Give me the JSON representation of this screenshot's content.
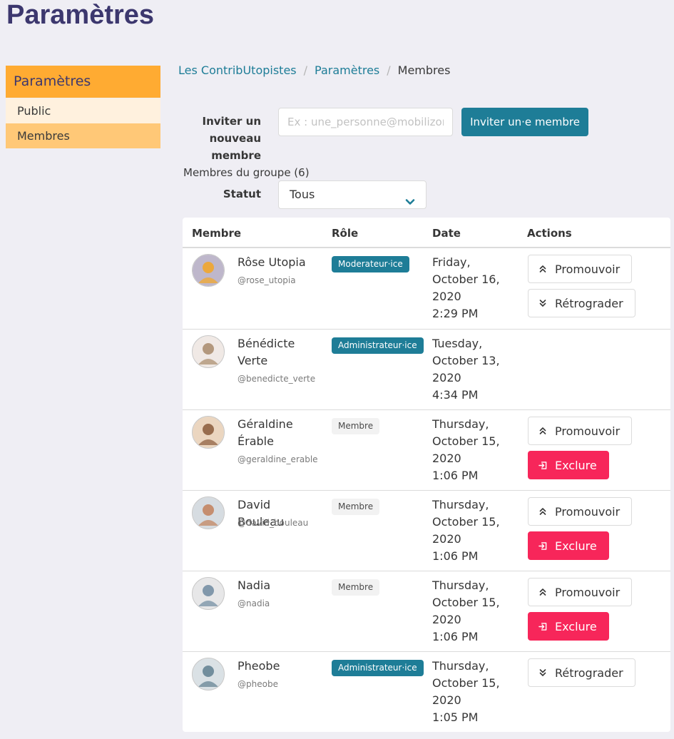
{
  "page": {
    "title": "Paramètres"
  },
  "sidebar": {
    "title": "Paramètres",
    "items": [
      {
        "label": "Public"
      },
      {
        "label": "Membres",
        "active": true
      }
    ]
  },
  "breadcrumb": [
    {
      "label": "Les ContribUtopistes"
    },
    {
      "label": "Paramètres"
    },
    {
      "label": "Membres"
    }
  ],
  "invite": {
    "label": "Inviter un nouveau membre",
    "placeholder": "Ex : une_personne@mobilizon.fr",
    "button": "Inviter un·e membre"
  },
  "group_members": {
    "label": "Membres du groupe (6)"
  },
  "status_filter": {
    "label": "Statut",
    "value": "Tous"
  },
  "table": {
    "headers": {
      "member": "Membre",
      "role": "Rôle",
      "date": "Date",
      "actions": "Actions"
    },
    "rows": [
      {
        "name": "Rôse Utopia",
        "handle": "@rose_utopia",
        "role": "Moderateur·ice",
        "role_style": "primary",
        "date": [
          "Friday,",
          "October 16,",
          "2020",
          "2:29 PM"
        ],
        "actions": [
          {
            "label": "Promouvoir",
            "kind": "promote"
          },
          {
            "label": "Rétrograder",
            "kind": "demote"
          }
        ]
      },
      {
        "name": "Bénédicte Verte",
        "handle": "@benedicte_verte",
        "role": "Administrateur·ice",
        "role_style": "primary",
        "date": [
          "Tuesday,",
          "October 13,",
          "2020",
          "4:34 PM"
        ],
        "actions": []
      },
      {
        "name": "Géraldine Érable",
        "handle": "@geraldine_erable",
        "role": "Membre",
        "role_style": "light",
        "date": [
          "Thursday,",
          "October 15,",
          "2020",
          "1:06 PM"
        ],
        "actions": [
          {
            "label": "Promouvoir",
            "kind": "promote"
          },
          {
            "label": "Exclure",
            "kind": "exclude"
          }
        ]
      },
      {
        "name": "David Bouleau",
        "handle": "@david_bouleau",
        "role": "Membre",
        "role_style": "light",
        "date": [
          "Thursday,",
          "October 15,",
          "2020",
          "1:06 PM"
        ],
        "actions": [
          {
            "label": "Promouvoir",
            "kind": "promote"
          },
          {
            "label": "Exclure",
            "kind": "exclude"
          }
        ]
      },
      {
        "name": "Nadia",
        "handle": "@nadia",
        "role": "Membre",
        "role_style": "light",
        "date": [
          "Thursday,",
          "October 15,",
          "2020",
          "1:06 PM"
        ],
        "actions": [
          {
            "label": "Promouvoir",
            "kind": "promote"
          },
          {
            "label": "Exclure",
            "kind": "exclude"
          }
        ]
      },
      {
        "name": "Pheobe",
        "handle": "@pheobe",
        "role": "Administrateur·ice",
        "role_style": "primary",
        "date": [
          "Thursday,",
          "October 15,",
          "2020",
          "1:05 PM"
        ],
        "actions": [
          {
            "label": "Rétrograder",
            "kind": "demote"
          }
        ]
      }
    ]
  },
  "colors": {
    "background": "#efeef4",
    "title": "#3c376e",
    "sidebar_header": "#ffab32",
    "sidebar_active": "#ffc877",
    "sidebar_item": "#fff1de",
    "primary": "#1e7d97",
    "danger": "#f7265a"
  },
  "icons": {
    "promote": "chevron-double-up-icon",
    "demote": "chevron-double-down-icon",
    "exclude": "exit-icon",
    "select": "chevron-down-icon"
  }
}
